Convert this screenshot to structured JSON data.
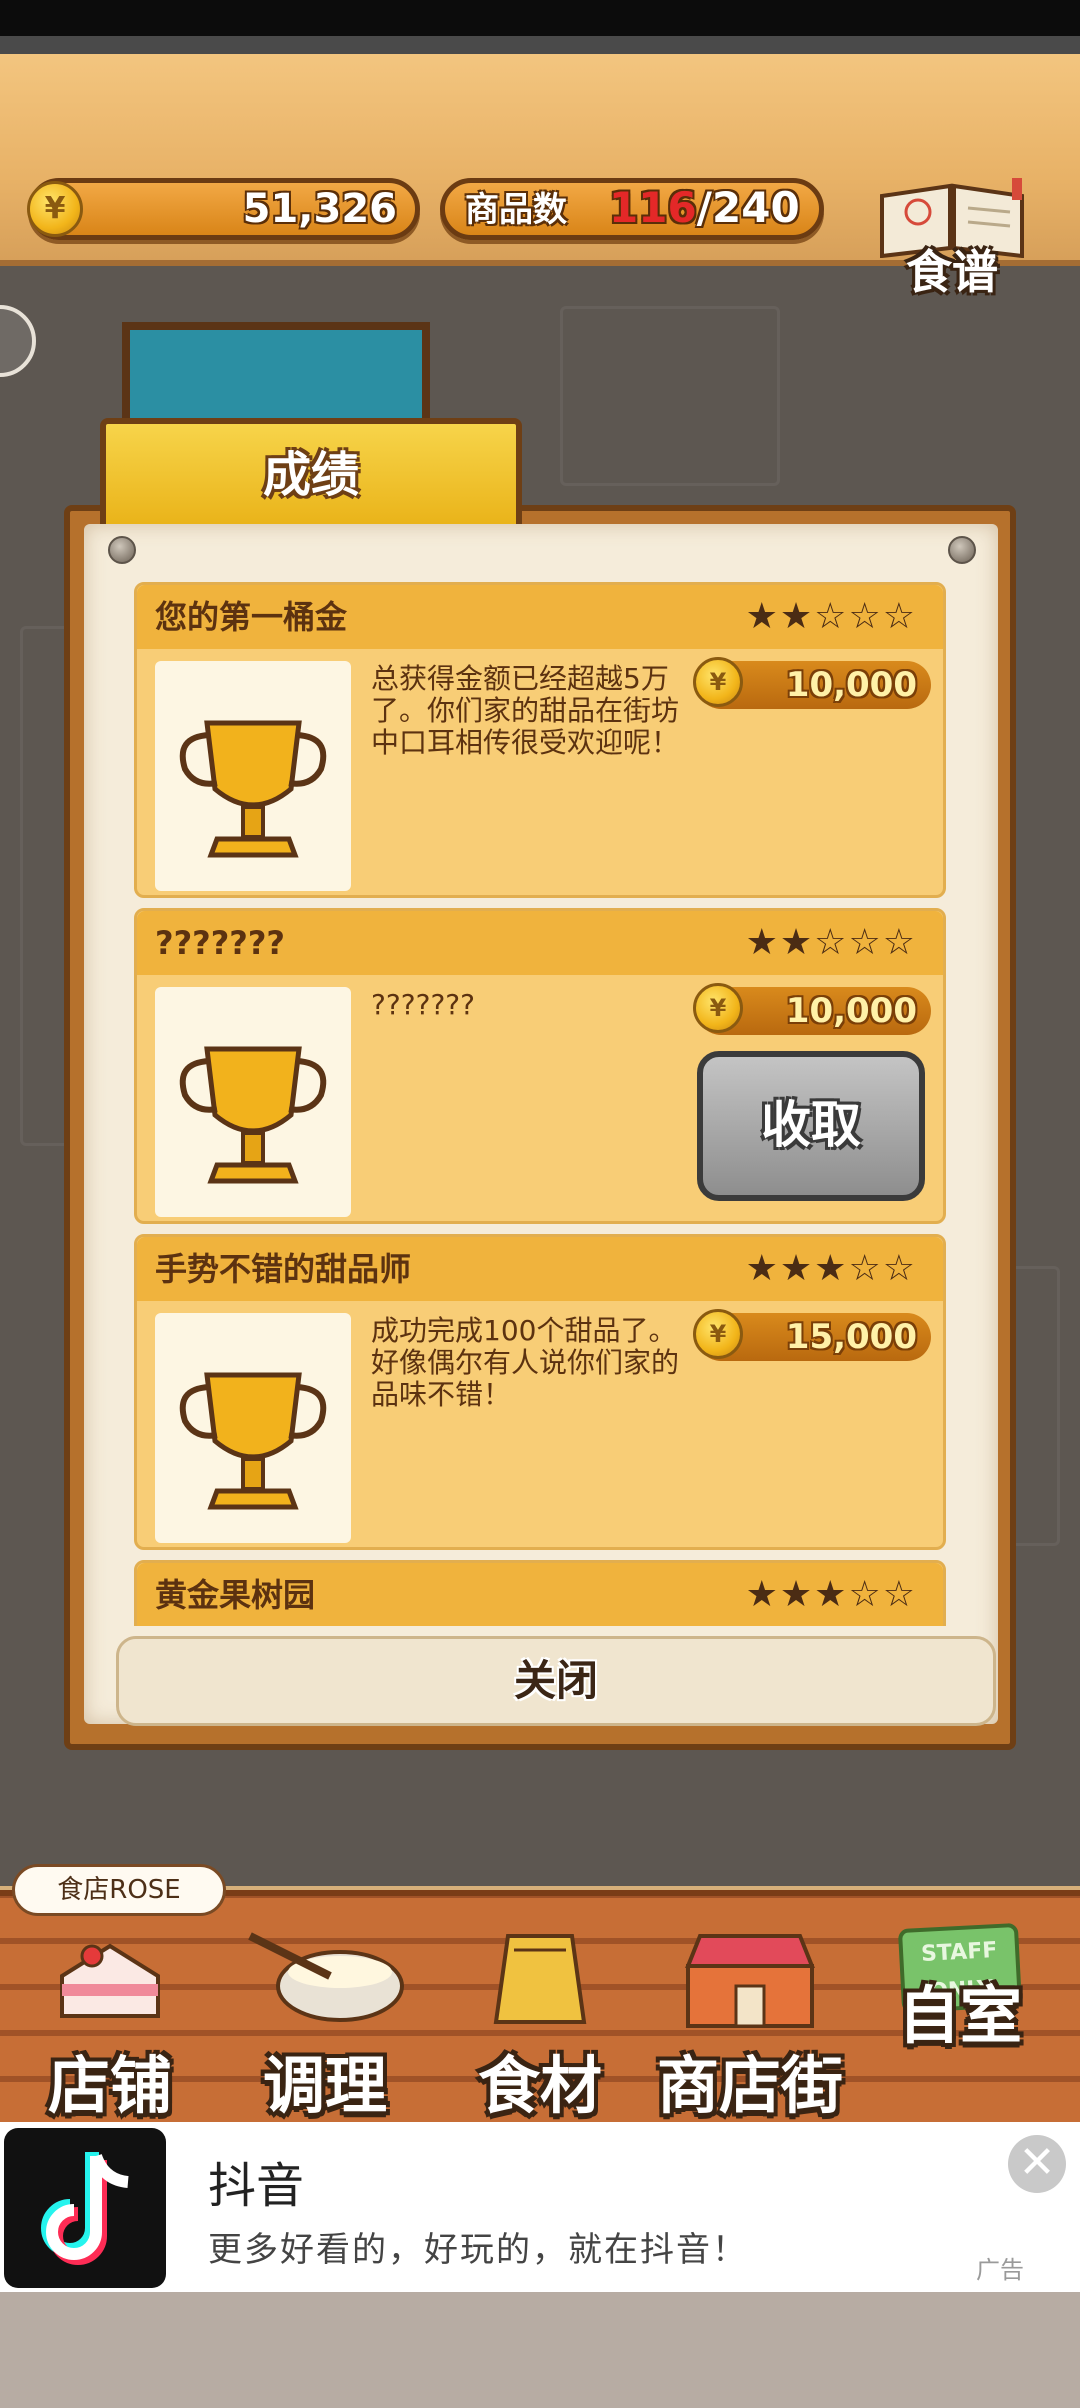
{
  "hud": {
    "coins": "51,326",
    "goods_label": "商品数",
    "goods_current": "116",
    "goods_sep": "/",
    "goods_max": "240",
    "recipe_label": "食谱",
    "currency_symbol": "¥"
  },
  "dialog": {
    "tab_title": "成绩",
    "close_label": "关闭",
    "achievements": [
      {
        "title": "您的第一桶金",
        "stars": "★★☆☆☆",
        "description": "总获得金额已经超越5万了。你们家的甜品在街坊中口耳相传很受欢迎呢！",
        "reward": "10,000"
      },
      {
        "title": "???????",
        "stars": "★★☆☆☆",
        "description": "???????",
        "reward": "10,000",
        "action": "收取"
      },
      {
        "title": "手势不错的甜品师",
        "stars": "★★★☆☆",
        "description": "成功完成100个甜品了。好像偶尔有人说你们家的品味不错！",
        "reward": "15,000"
      },
      {
        "title": "黄金果树园",
        "stars": "★★★☆☆"
      }
    ]
  },
  "nav": {
    "shop_tag": "食店ROSE",
    "items": [
      {
        "label": "店铺",
        "icon": "cake-icon"
      },
      {
        "label": "调理",
        "icon": "whisk-bowl-icon"
      },
      {
        "label": "食材",
        "icon": "flour-sack-icon"
      },
      {
        "label": "商店街",
        "icon": "storefront-icon"
      },
      {
        "label": "自室",
        "icon": "staff-only-sign-icon"
      }
    ],
    "staff_sign": "STAFF ONLY"
  },
  "ad": {
    "title": "抖音",
    "subtitle": "更多好看的，好玩的，就在抖音！",
    "badge": "广告",
    "close_symbol": "✕"
  }
}
